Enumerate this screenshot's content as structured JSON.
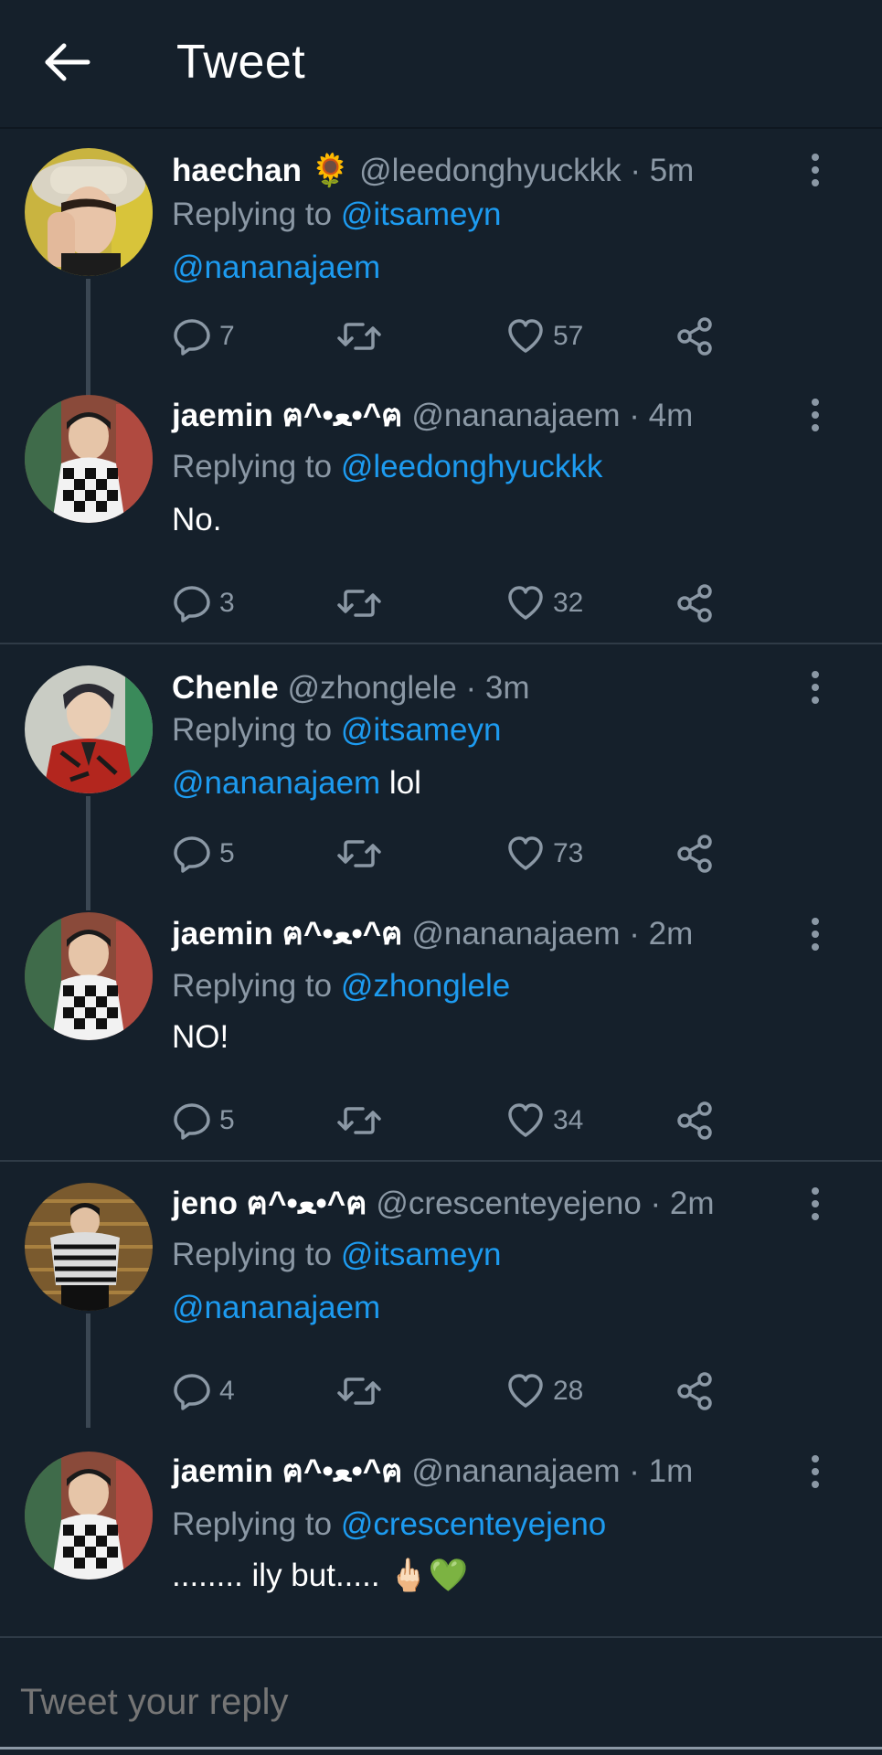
{
  "header": {
    "title": "Tweet"
  },
  "tweets": [
    {
      "name": "haechan",
      "name_emoji": "🌻",
      "handle": "@leedonghyuckkk",
      "time": "· 5m",
      "replying_prefix": "Replying to",
      "replying_to": "@itsameyn",
      "body_mention": "@nananajaem",
      "body_text": "",
      "replies": "7",
      "likes": "57"
    },
    {
      "name": "jaemin ฅ^•ﻌ•^ฅ",
      "handle": "@nananajaem",
      "time": "· 4m",
      "replying_prefix": "Replying to",
      "replying_to": "@leedonghyuckkk",
      "body_text": "No.",
      "replies": "3",
      "likes": "32"
    },
    {
      "name": "Chenle",
      "handle": "@zhonglele",
      "time": "· 3m",
      "replying_prefix": "Replying to",
      "replying_to": "@itsameyn",
      "body_mention": "@nananajaem",
      "body_text": " lol",
      "replies": "5",
      "likes": "73"
    },
    {
      "name": "jaemin ฅ^•ﻌ•^ฅ",
      "handle": "@nananajaem",
      "time": "· 2m",
      "replying_prefix": "Replying to",
      "replying_to": "@zhonglele",
      "body_text": "NO!",
      "replies": "5",
      "likes": "34"
    },
    {
      "name": "jeno ฅ^•ﻌ•^ฅ",
      "handle": "@crescenteyejeno",
      "time": "· 2m",
      "replying_prefix": "Replying to",
      "replying_to": "@itsameyn",
      "body_mention": "@nananajaem",
      "body_text": "",
      "replies": "4",
      "likes": "28"
    },
    {
      "name": "jaemin ฅ^•ﻌ•^ฅ",
      "handle": "@nananajaem",
      "time": "· 1m",
      "replying_prefix": "Replying to",
      "replying_to": "@crescenteyejeno",
      "body_text": "........ ily but.....",
      "body_emoji": "🖕🏻💚",
      "replies": "",
      "likes": ""
    }
  ],
  "compose": {
    "placeholder": "Tweet your reply"
  },
  "icons": {
    "back": "arrow-left-icon",
    "reply": "speech-bubble-icon",
    "retweet": "retweet-icon",
    "like": "heart-icon",
    "share": "share-icon",
    "more": "vertical-ellipsis-icon"
  },
  "colors": {
    "background": "#15202b",
    "link": "#1d9bf0",
    "muted": "#8b98a5",
    "divider": "#2f3b47"
  }
}
